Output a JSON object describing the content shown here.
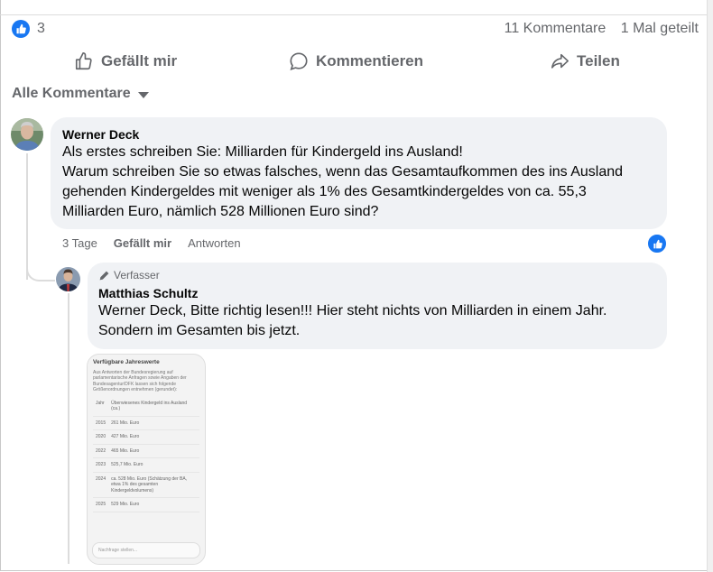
{
  "stats": {
    "like_count": "3",
    "comments": "11 Kommentare",
    "shares": "1 Mal geteilt"
  },
  "actions": {
    "like": "Gefällt mir",
    "comment": "Kommentieren",
    "share": "Teilen"
  },
  "filter": {
    "label": "Alle Kommentare"
  },
  "comments": [
    {
      "author": "Werner Deck",
      "lines": [
        "Als erstes schreiben Sie: Milliarden für Kindergeld ins Ausland!",
        "Warum schreiben Sie so etwas falsches, wenn das Gesamtaufkommen des ins Ausland",
        "gehenden Kindergeldes mit weniger als 1% des Gesamtkindergeldes von ca. 55,3",
        "Milliarden Euro, nämlich 528 Millionen Euro sind?"
      ],
      "time": "3 Tage",
      "like": "Gefällt mir",
      "reply": "Antworten"
    },
    {
      "badge": "Verfasser",
      "author": "Matthias Schultz",
      "lines": [
        "Werner Deck, Bitte richtig lesen!!! Hier steht nichts von Milliarden in einem Jahr.",
        "Sondern im Gesamten bis jetzt."
      ]
    }
  ],
  "attachment": {
    "title": "Verfügbare Jahreswerte",
    "intro": "Aus Antworten der Bundesregierung auf parlamentarische Anfragen sowie Angaben der Bundesagentur/DFK lassen sich folgende Größenordnungen entnehmen (gerundet):",
    "head": [
      "Jahr",
      "Überwiesenes Kindergeld ins Ausland (ca.)"
    ],
    "rows": [
      [
        "2015",
        "261 Mio. Euro"
      ],
      [
        "2020",
        "427 Mio. Euro"
      ],
      [
        "2022",
        "465 Mio. Euro"
      ],
      [
        "2023",
        "525,7 Mio. Euro"
      ],
      [
        "2024",
        "ca. 528 Mio. Euro (Schätzung der BA, etwa 1% des gesamten Kindergeldvolumens)"
      ],
      [
        "2025",
        "529 Mio. Euro"
      ]
    ],
    "input_placeholder": "Nachfrage stellen..."
  },
  "colors": {
    "accent": "#1877f2",
    "muted": "#65676b",
    "bubble": "#f0f2f5"
  }
}
